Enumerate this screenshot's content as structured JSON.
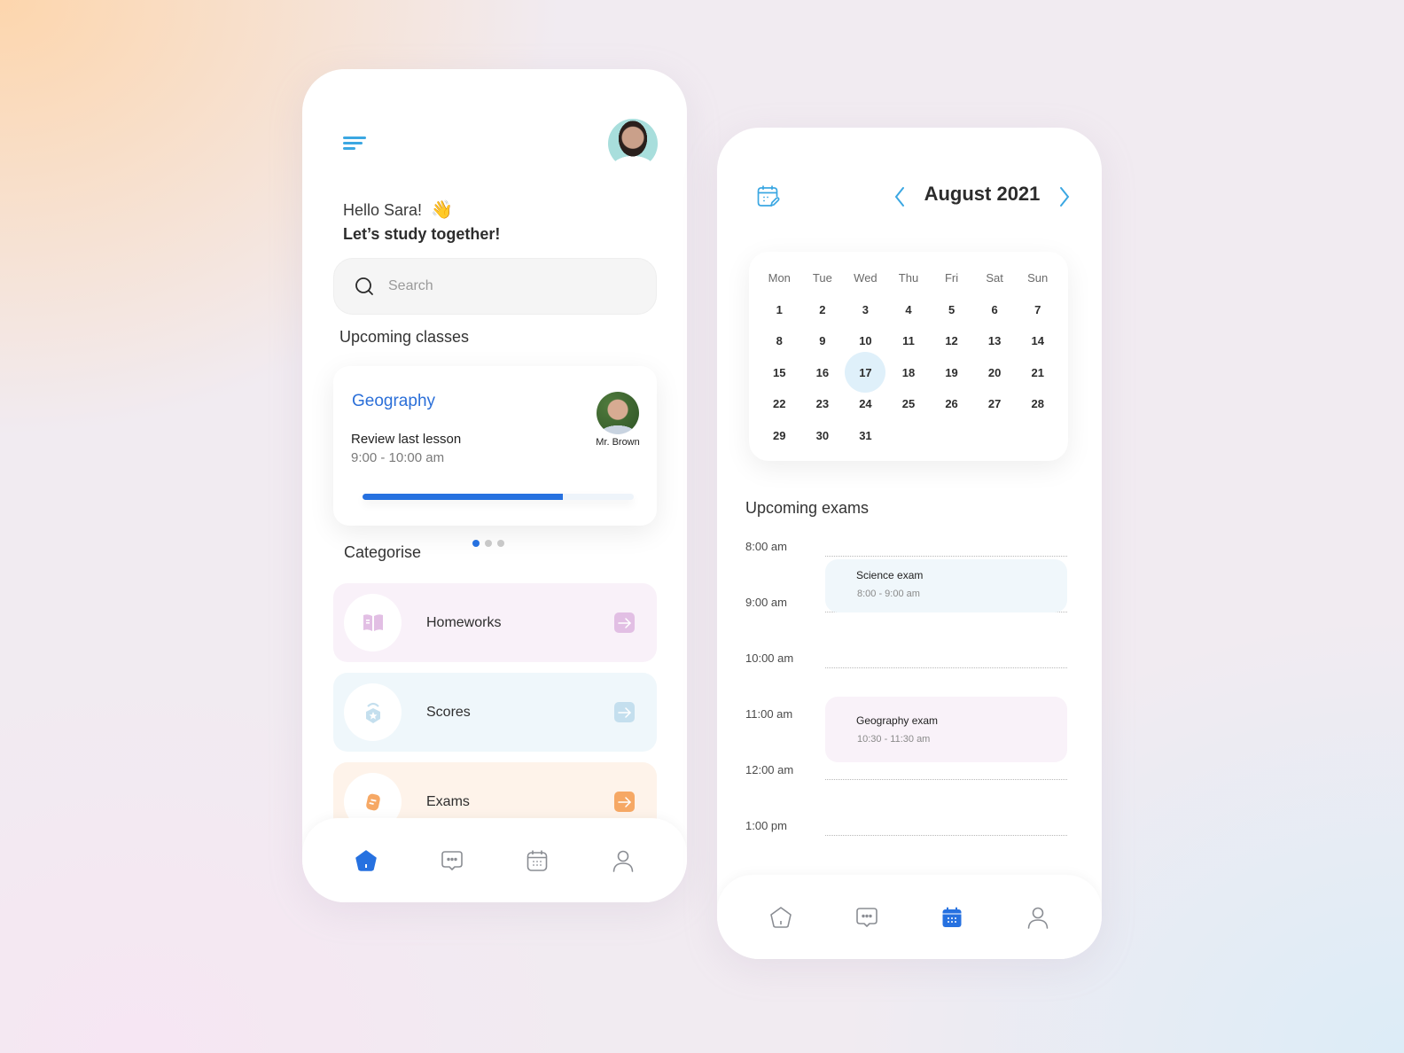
{
  "home": {
    "greeting": "Hello Sara!",
    "wave_emoji": "👋",
    "tagline": "Let’s study together!",
    "search": {
      "placeholder": "Search",
      "value": ""
    },
    "upcoming_title": "Upcoming classes",
    "class_card": {
      "subject": "Geography",
      "topic": "Review last lesson",
      "time": "9:00 - 10:00 am",
      "teacher": "Mr. Brown",
      "progress_percent": 74
    },
    "carousel": {
      "count": 3,
      "active_index": 0
    },
    "categories_title": "Categorise",
    "categories": [
      {
        "label": "Homeworks",
        "icon": "book-icon",
        "bg": "#f9f1f9",
        "accent": "#e2bfe4"
      },
      {
        "label": "Scores",
        "icon": "medal-icon",
        "bg": "#eff7fb",
        "accent": "#c4dfee"
      },
      {
        "label": "Exams",
        "icon": "exam-paper-icon",
        "bg": "#fef3ea",
        "accent": "#f6a865"
      }
    ],
    "nav": {
      "active": "home",
      "items": [
        "home",
        "messages",
        "calendar",
        "profile"
      ]
    }
  },
  "calendar": {
    "month_title": "August 2021",
    "weekdays": [
      "Mon",
      "Tue",
      "Wed",
      "Thu",
      "Fri",
      "Sat",
      "Sun"
    ],
    "days": [
      "1",
      "2",
      "3",
      "4",
      "5",
      "6",
      "7",
      "8",
      "9",
      "10",
      "11",
      "12",
      "13",
      "14",
      "15",
      "16",
      "17",
      "18",
      "19",
      "20",
      "21",
      "22",
      "23",
      "24",
      "25",
      "26",
      "27",
      "28",
      "29",
      "30",
      "31"
    ],
    "today": "17",
    "exams_title": "Upcoming exams",
    "time_slots": [
      "8:00 am",
      "9:00 am",
      "10:00 am",
      "11:00 am",
      "12:00 am",
      "1:00 pm"
    ],
    "exams": [
      {
        "name": "Science exam",
        "time": "8:00 - 9:00 am",
        "bg": "#f0f7fb"
      },
      {
        "name": "Geography exam",
        "time": "10:30 - 11:30 am",
        "bg": "#f9f2f9"
      }
    ],
    "nav": {
      "active": "calendar",
      "items": [
        "home",
        "messages",
        "calendar",
        "profile"
      ]
    }
  },
  "colors": {
    "primary": "#2671e0",
    "accent_light_blue": "#3ba7e2",
    "inactive_icon": "#8a8d93"
  }
}
